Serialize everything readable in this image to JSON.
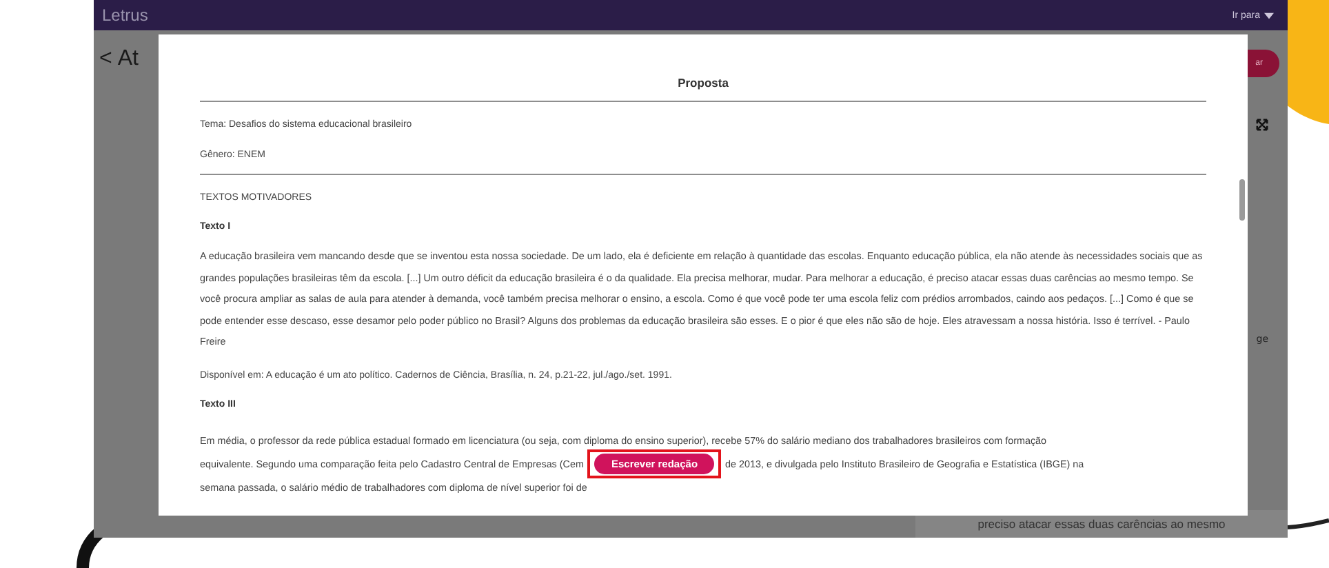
{
  "app": {
    "logo": "Letrus",
    "nav_menu": "Ir para"
  },
  "background": {
    "back_mark": "<",
    "page_title": "At",
    "action_button": "ar",
    "side_text": "ge",
    "card_text": "preciso atacar essas duas carências ao mesmo"
  },
  "modal": {
    "title": "Proposta",
    "theme": "Tema: Desafios do sistema educacional brasileiro",
    "genre": "Gênero: ENEM",
    "section": "TEXTOS MOTIVADORES",
    "texts": [
      {
        "heading": "Texto I",
        "paragraph": "A educação brasileira vem mancando desde que se inventou esta nossa sociedade. De um lado, ela é deficiente em relação à quantidade das escolas. Enquanto educação pública, ela não atende às necessidades sociais que as grandes populações brasileiras têm da escola. [...] Um outro déficit da educação brasileira é o da qualidade. Ela precisa melhorar, mudar. Para melhorar a educação, é preciso atacar essas duas carências ao mesmo tempo. Se você procura ampliar as salas de aula para atender à demanda, você também precisa melhorar o ensino, a escola. Como é que você pode ter uma escola feliz com prédios arrombados, caindo aos pedaços. [...] Como é que se pode entender esse descaso, esse desamor pelo poder público no Brasil? Alguns dos problemas da educação brasileira são esses. E o pior é que eles não são de hoje. Eles atravessam a nossa história. Isso é terrível. - Paulo Freire",
        "source": "Disponível em: A educação é um ato político. Cadernos de Ciência, Brasília, n. 24, p.21-22, jul./ago./set. 1991."
      },
      {
        "heading": "Texto III",
        "lines": [
          "Em média, o professor da rede pública estadual formado em licenciatura (ou seja, com diploma do ensino superior), recebe 57% do salário mediano dos trabalhadores brasileiros com formação",
          "equivalente. Segundo uma comparação feita pelo Cadastro Central de Empresas (Cem",
          "de 2013, e divulgada pelo Instituto Brasileiro de Geografia e Estatística (IBGE) na",
          "semana passada, o salário médio de trabalhadores com diploma de nível superior foi de"
        ]
      }
    ],
    "write_button": "Escrever redação",
    "highlighted": true
  }
}
